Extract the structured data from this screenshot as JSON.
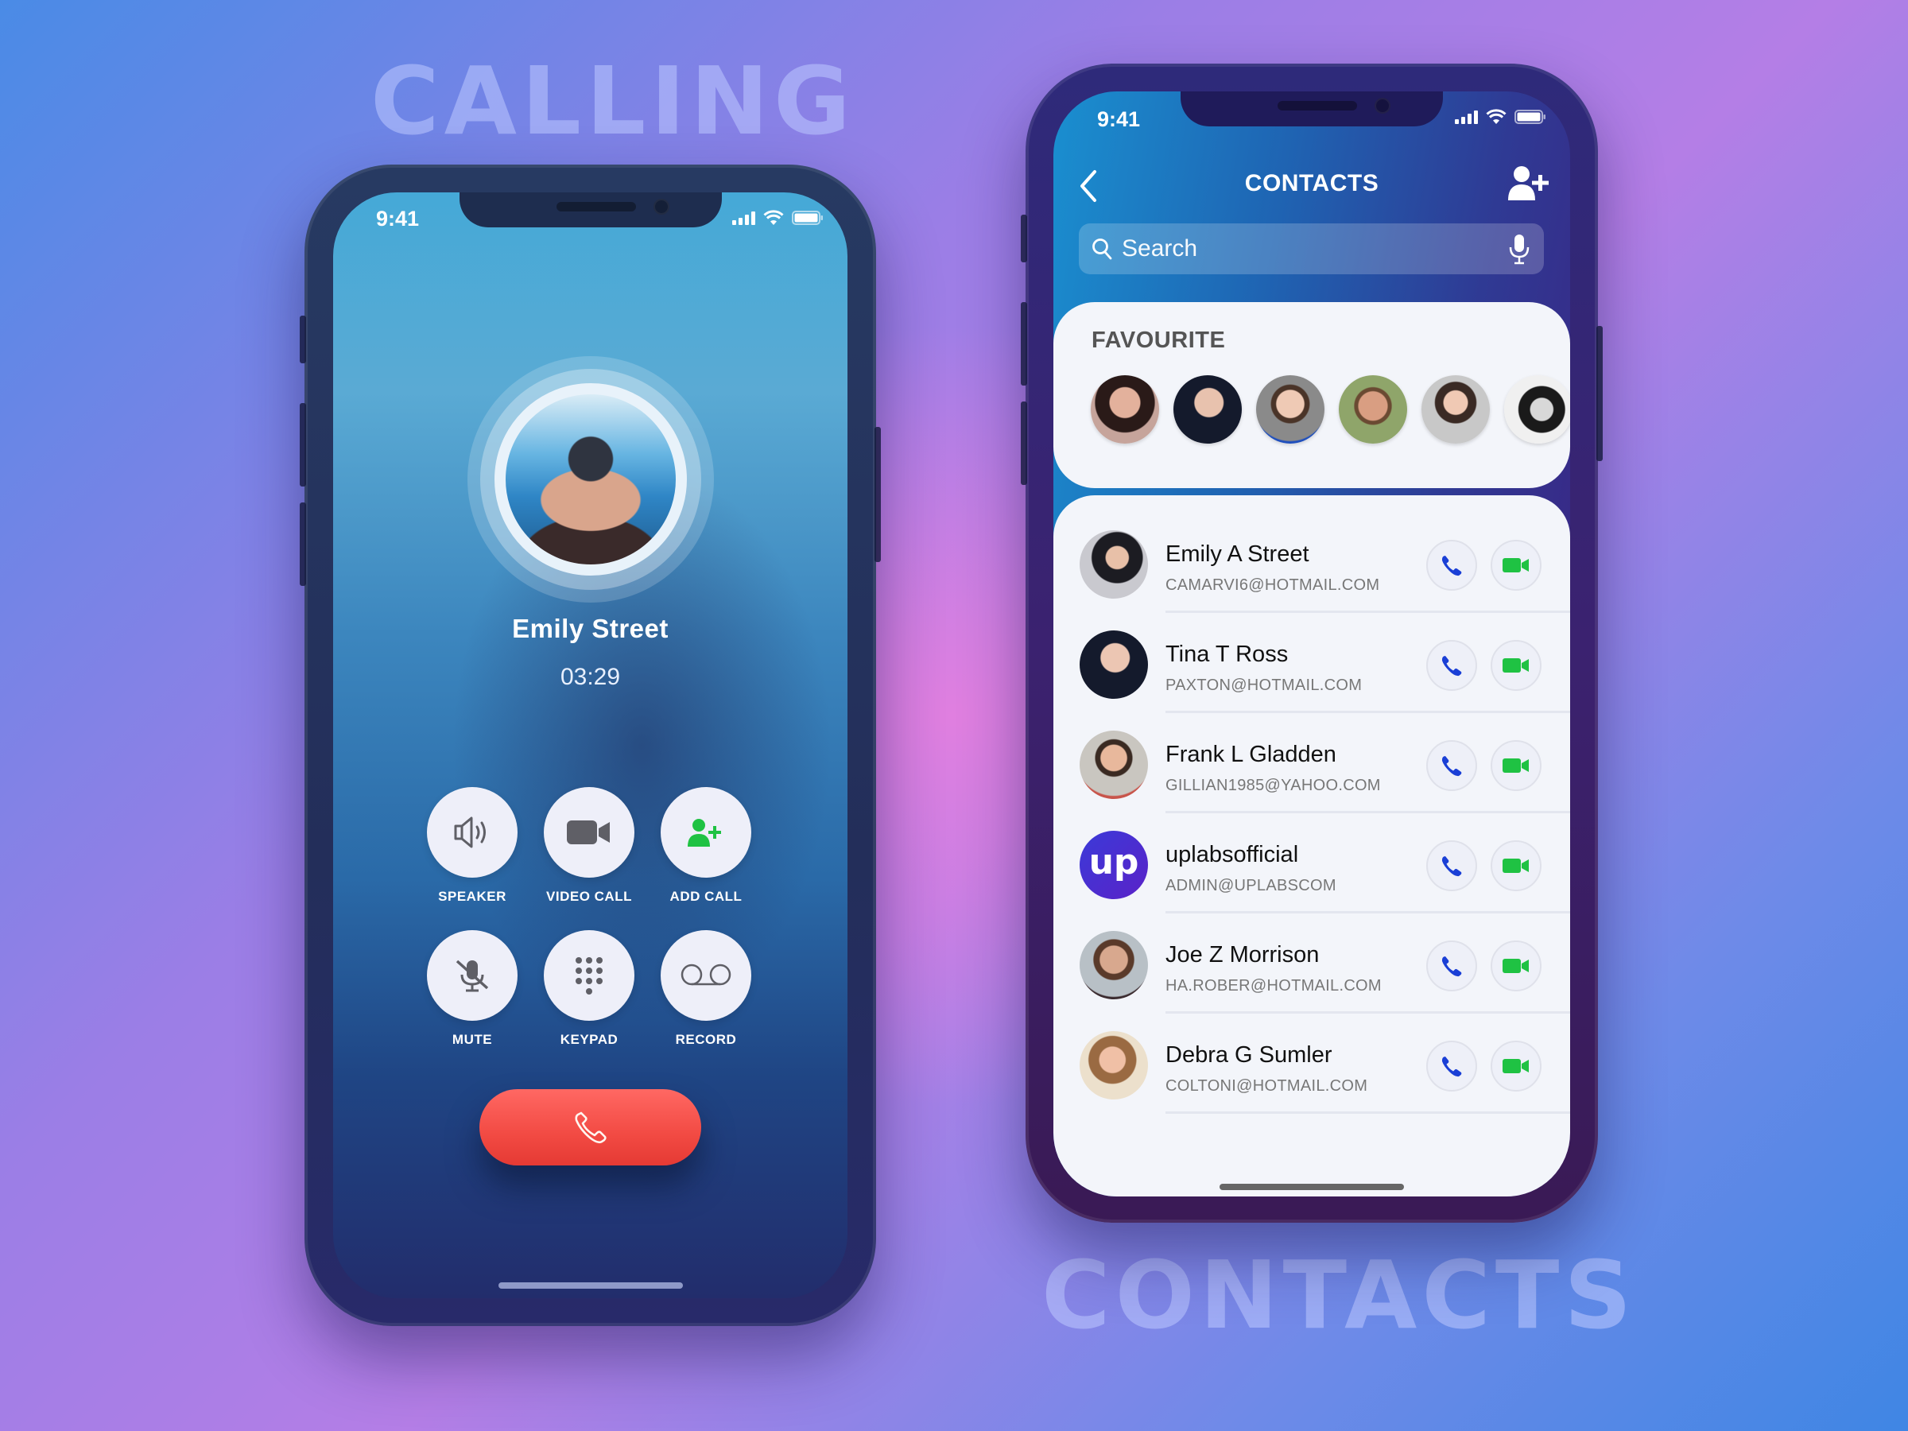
{
  "background_labels": {
    "calling": "CALLING",
    "contacts": "CONTACTS"
  },
  "colors": {
    "end_call": "#f24a43",
    "call_icon": "#1a3fd6",
    "video_icon": "#1fc243",
    "add_call_icon": "#1fc243",
    "uplabs_brand": "#4b2ad6"
  },
  "calling_screen": {
    "status_bar": {
      "time": "9:41"
    },
    "caller": {
      "name": "Emily Street",
      "duration": "03:29"
    },
    "controls": [
      {
        "id": "speaker",
        "label": "SPEAKER",
        "icon": "speaker-icon"
      },
      {
        "id": "video-call",
        "label": "VIDEO CALL",
        "icon": "video-camera-icon"
      },
      {
        "id": "add-call",
        "label": "ADD CALL",
        "icon": "add-user-icon"
      },
      {
        "id": "mute",
        "label": "MUTE",
        "icon": "mic-off-icon"
      },
      {
        "id": "keypad",
        "label": "KEYPAD",
        "icon": "keypad-icon"
      },
      {
        "id": "record",
        "label": "RECORD",
        "icon": "voicemail-icon"
      }
    ],
    "end_call_icon": "phone-hangup-icon"
  },
  "contacts_screen": {
    "status_bar": {
      "time": "9:41"
    },
    "header": {
      "title": "CONTACTS",
      "back_icon": "chevron-left-icon",
      "add_icon": "add-user-icon"
    },
    "search": {
      "placeholder": "Search",
      "value": ""
    },
    "favourites": {
      "title": "FAVOURITE",
      "count_visible": 6
    },
    "contacts": [
      {
        "name": "Emily A Street",
        "email": "CAMARVI6@HOTMAIL.COM"
      },
      {
        "name": "Tina T Ross",
        "email": "PAXTON@HOTMAIL.COM"
      },
      {
        "name": "Frank L Gladden",
        "email": "GILLIAN1985@YAHOO.COM"
      },
      {
        "name": "uplabsofficial",
        "email": "ADMIN@UPLABSCOM",
        "avatar_text": "up"
      },
      {
        "name": "Joe Z Morrison",
        "email": "HA.ROBER@HOTMAIL.COM"
      },
      {
        "name": "Debra G Sumler",
        "email": "COLTONI@HOTMAIL.COM"
      }
    ]
  }
}
